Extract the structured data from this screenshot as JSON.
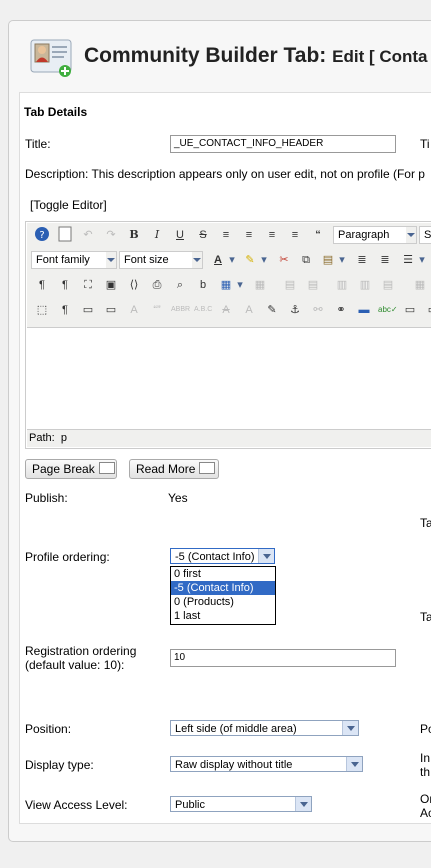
{
  "header": {
    "title": "Community Builder Tab:",
    "subtitle": "Edit [ Conta",
    "icon": "user-card-add-icon"
  },
  "section_heading": "Tab Details",
  "title_field": {
    "label": "Title:",
    "value": "_UE_CONTACT_INFO_HEADER",
    "right_clip": "Ti"
  },
  "description": {
    "text": "Description: This description appears only on user edit, not on profile (For p",
    "toggle_editor": "[Toggle Editor]"
  },
  "editor": {
    "format_select": "Paragraph",
    "style_select_clip": "St",
    "font_family": "Font family",
    "font_size": "Font size",
    "path_label": "Path:",
    "path_value": "p"
  },
  "buttons": {
    "page_break": "Page Break",
    "read_more": "Read More"
  },
  "publish": {
    "label": "Publish:",
    "value": "Yes",
    "right_clip": "Ta"
  },
  "profile_ordering": {
    "label": "Profile ordering:",
    "selected": "-5 (Contact Info)",
    "options": [
      "0 first",
      "-5 (Contact Info)",
      "0 (Products)",
      "1 last"
    ],
    "right_clip": "Ta"
  },
  "registration_ordering": {
    "label_line1": "Registration ordering",
    "label_line2": "(default value: 10):",
    "value": "10"
  },
  "position": {
    "label": "Position:",
    "value": "Left side (of middle area)",
    "right_clip": "Po"
  },
  "display_type": {
    "label": "Display type:",
    "value": "Raw display without title",
    "right_clip1": "In",
    "right_clip2": "th"
  },
  "view_access": {
    "label": "View Access Level:",
    "value": "Public",
    "right_clip1": "Or",
    "right_clip2": "Ac"
  },
  "colors": {
    "selection": "#316ac5",
    "select_border": "#8fa3bf",
    "panel_bg": "#f7f7f7"
  }
}
